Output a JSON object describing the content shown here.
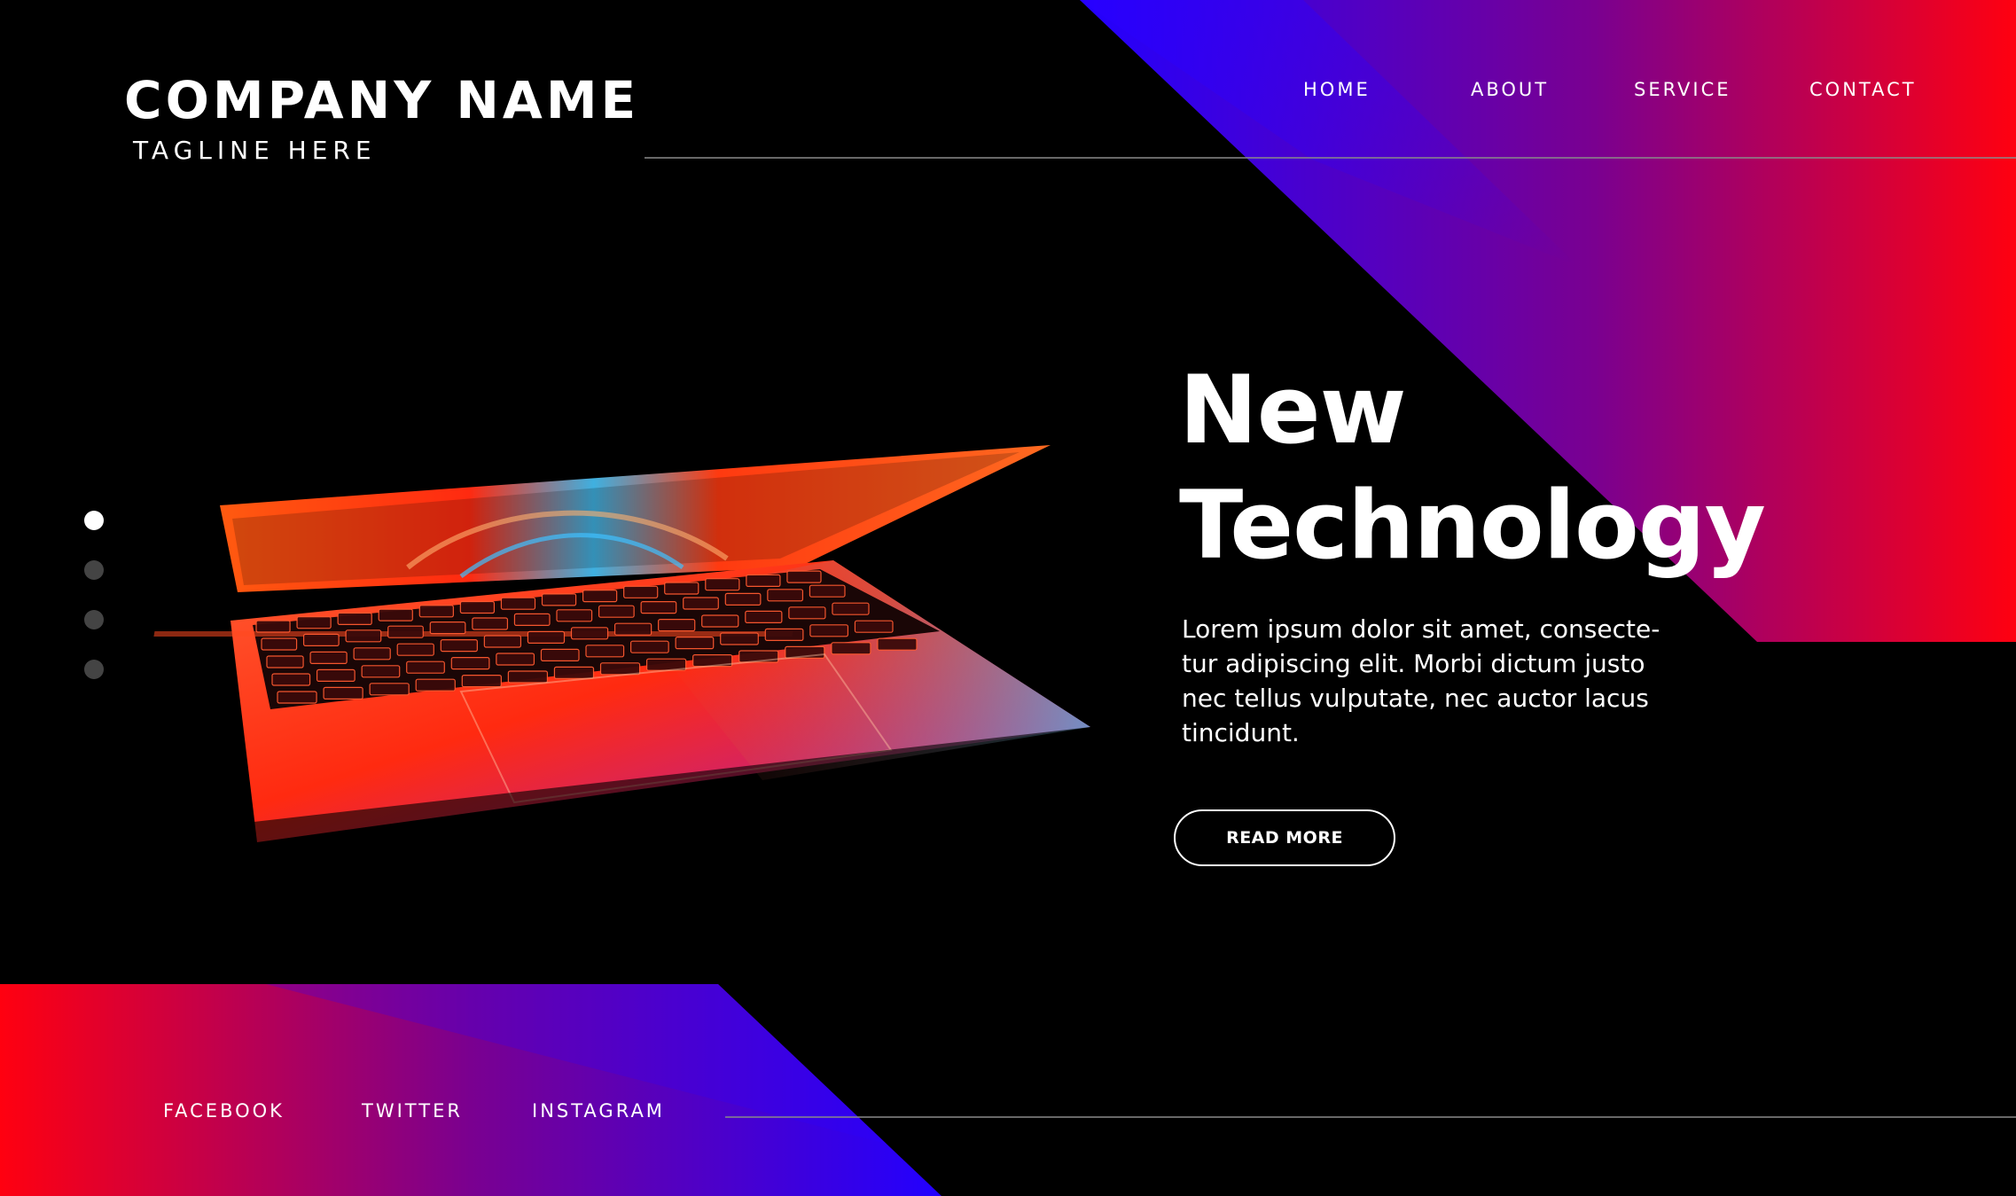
{
  "brand": {
    "company_name": "COMPANY NAME",
    "tagline": "TAGLINE HERE"
  },
  "nav": {
    "items": [
      {
        "label": "HOME"
      },
      {
        "label": "ABOUT"
      },
      {
        "label": "SERVICE"
      },
      {
        "label": "CONTACT"
      }
    ]
  },
  "hero": {
    "title_line1": "New",
    "title_line2": "Technology",
    "body_lines": [
      "Lorem ipsum dolor sit amet, consecte-",
      "tur adipiscing elit. Morbi dictum justo",
      "nec tellus vulputate, nec auctor lacus",
      "tincidunt."
    ],
    "cta_label": "READ MORE"
  },
  "slider": {
    "count": 4,
    "active_index": 0
  },
  "social": {
    "items": [
      {
        "label": "FACEBOOK"
      },
      {
        "label": "TWITTER"
      },
      {
        "label": "INSTAGRAM"
      }
    ]
  },
  "colors": {
    "background": "#000000",
    "gradient_blue": "#2200ff",
    "gradient_purple": "#7a0090",
    "gradient_red": "#ff0010",
    "dot_inactive": "#444444",
    "divider": "#8a8a8a"
  },
  "icons": [
    "laptop-image"
  ]
}
